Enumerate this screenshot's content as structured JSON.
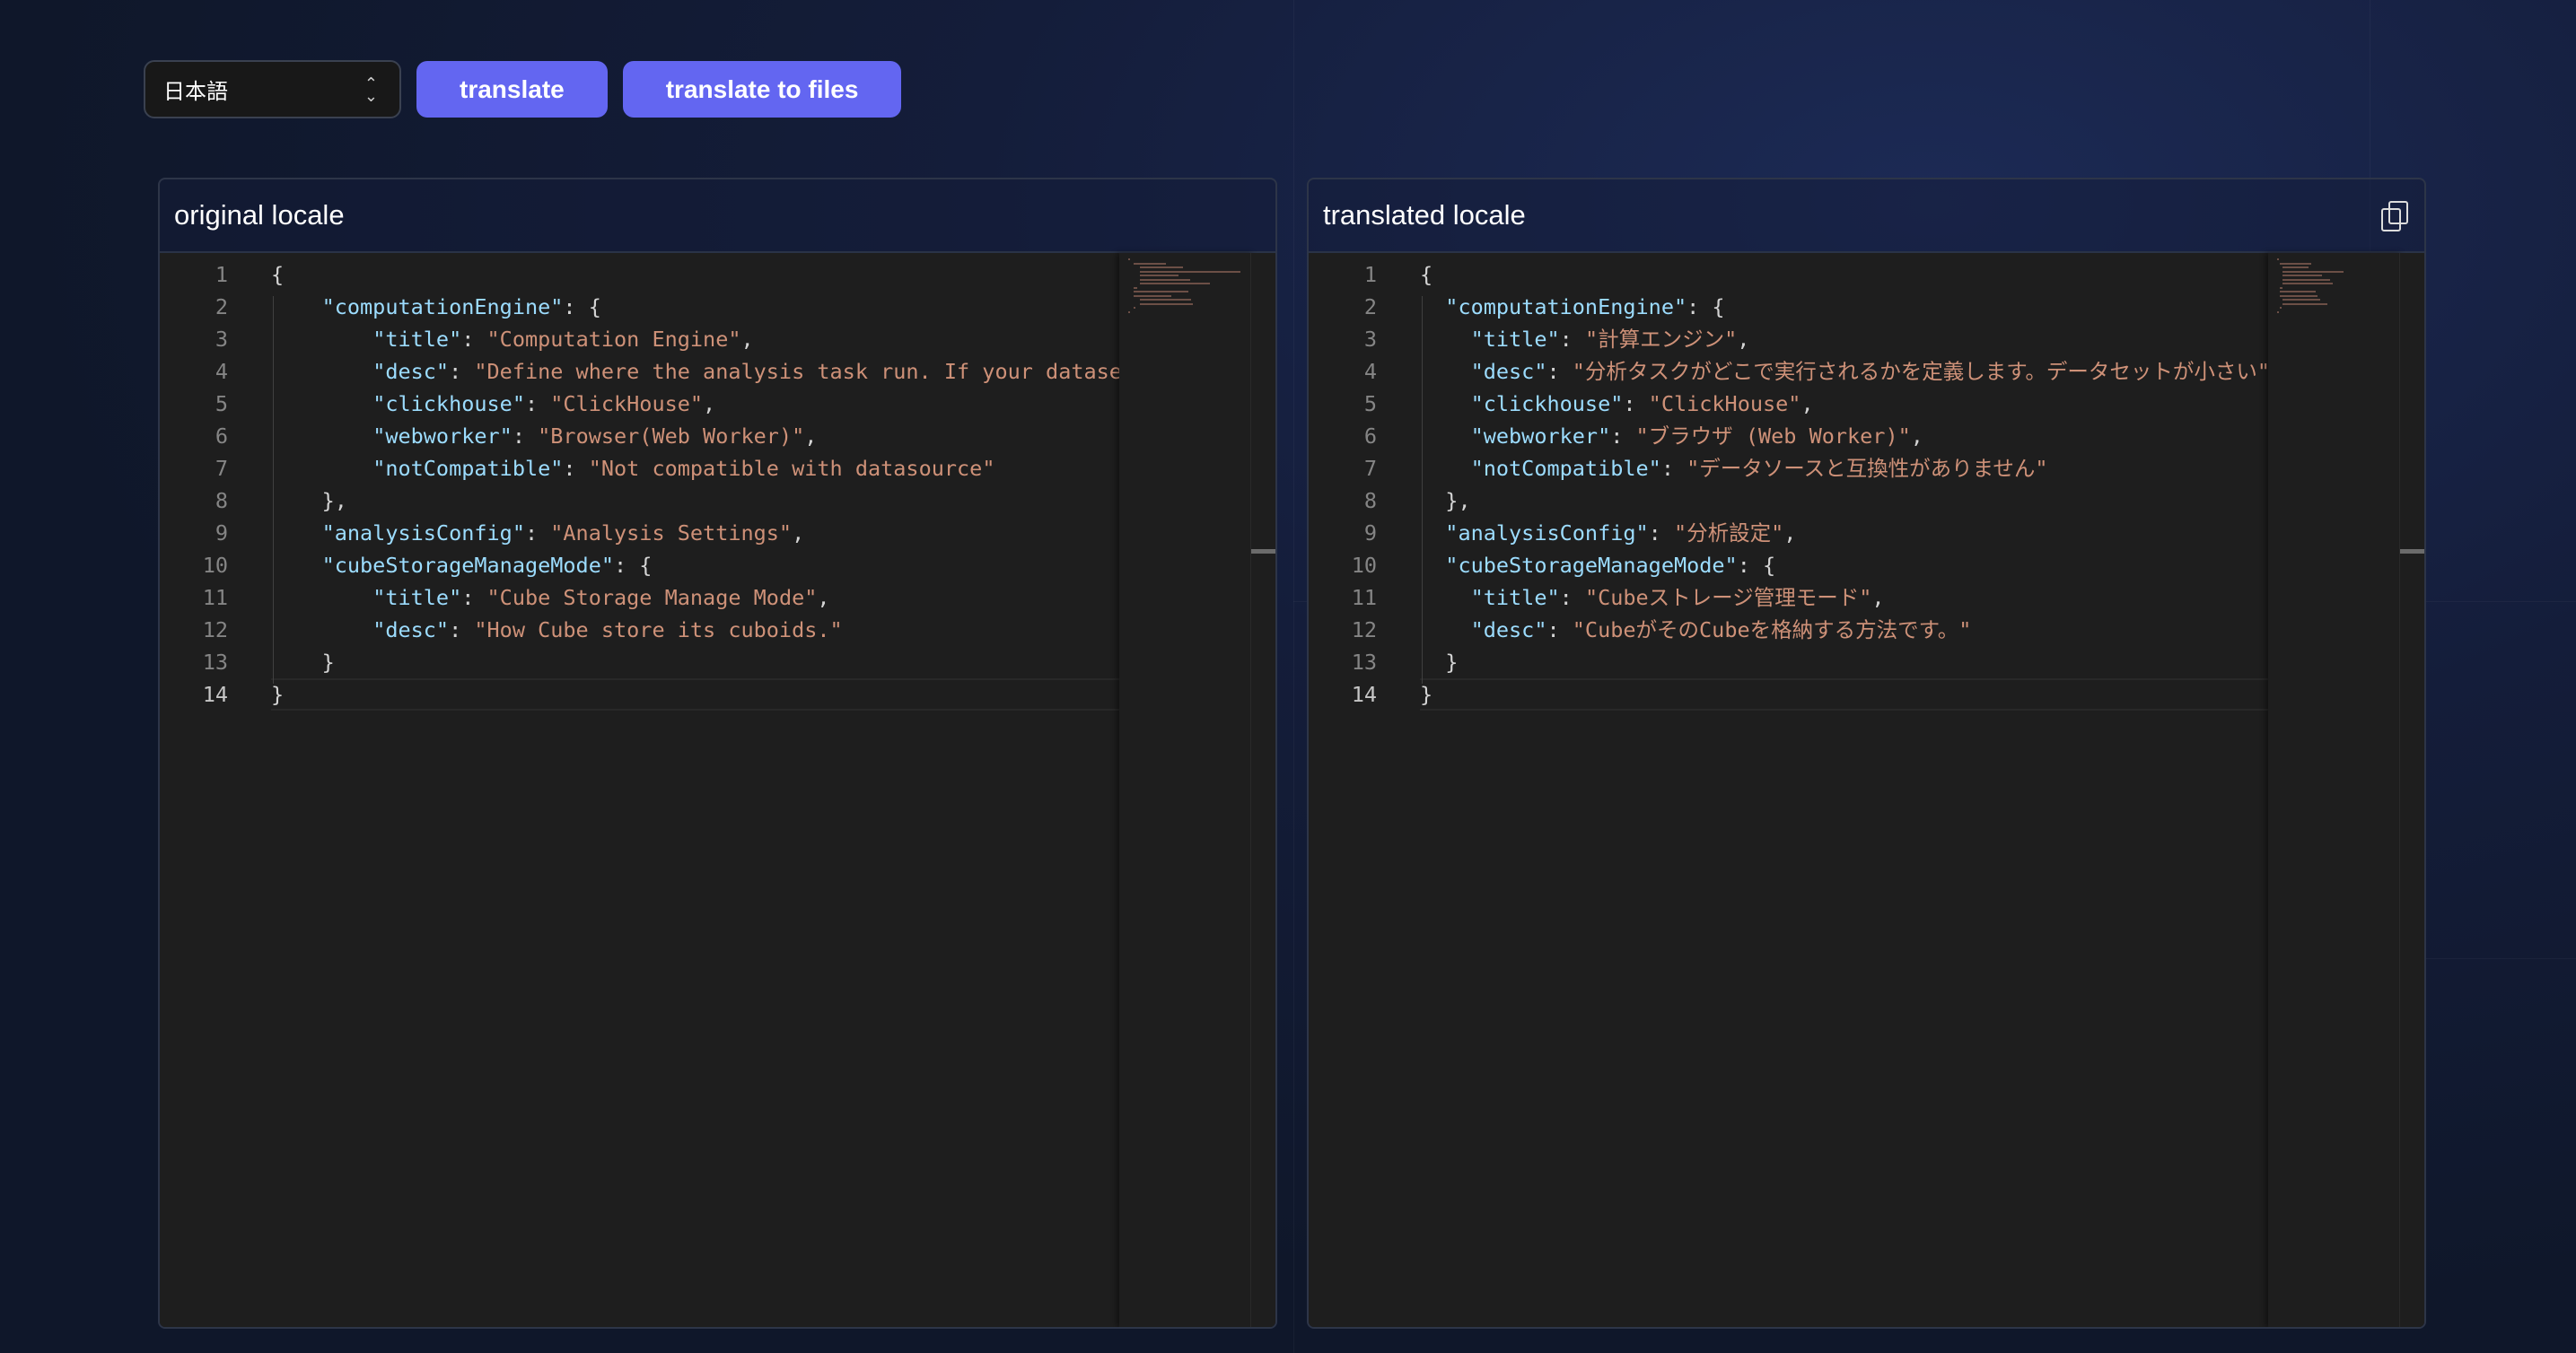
{
  "toolbar": {
    "language_select": {
      "value": "日本語"
    },
    "translate_label": "translate",
    "translate_files_label": "translate to files"
  },
  "colors": {
    "accent": "#6366f1",
    "editor_bg": "#1e1e1e",
    "json_key": "#9cdcfe",
    "json_string": "#ce9178"
  },
  "panels": [
    {
      "title": "original locale",
      "lines": [
        [
          [
            "p",
            "{"
          ]
        ],
        [
          [
            "p",
            "    "
          ],
          [
            "k",
            "\"computationEngine\""
          ],
          [
            "p",
            ": {"
          ]
        ],
        [
          [
            "p",
            "        "
          ],
          [
            "k",
            "\"title\""
          ],
          [
            "p",
            ": "
          ],
          [
            "s",
            "\"Computation Engine\""
          ],
          [
            "p",
            ","
          ]
        ],
        [
          [
            "p",
            "        "
          ],
          [
            "k",
            "\"desc\""
          ],
          [
            "p",
            ": "
          ],
          [
            "s",
            "\"Define where the analysis task run. If your dataset is small\""
          ]
        ],
        [
          [
            "p",
            "        "
          ],
          [
            "k",
            "\"clickhouse\""
          ],
          [
            "p",
            ": "
          ],
          [
            "s",
            "\"ClickHouse\""
          ],
          [
            "p",
            ","
          ]
        ],
        [
          [
            "p",
            "        "
          ],
          [
            "k",
            "\"webworker\""
          ],
          [
            "p",
            ": "
          ],
          [
            "s",
            "\"Browser(Web Worker)\""
          ],
          [
            "p",
            ","
          ]
        ],
        [
          [
            "p",
            "        "
          ],
          [
            "k",
            "\"notCompatible\""
          ],
          [
            "p",
            ": "
          ],
          [
            "s",
            "\"Not compatible with datasource\""
          ]
        ],
        [
          [
            "p",
            "    },"
          ]
        ],
        [
          [
            "p",
            "    "
          ],
          [
            "k",
            "\"analysisConfig\""
          ],
          [
            "p",
            ": "
          ],
          [
            "s",
            "\"Analysis Settings\""
          ],
          [
            "p",
            ","
          ]
        ],
        [
          [
            "p",
            "    "
          ],
          [
            "k",
            "\"cubeStorageManageMode\""
          ],
          [
            "p",
            ": {"
          ]
        ],
        [
          [
            "p",
            "        "
          ],
          [
            "k",
            "\"title\""
          ],
          [
            "p",
            ": "
          ],
          [
            "s",
            "\"Cube Storage Manage Mode\""
          ],
          [
            "p",
            ","
          ]
        ],
        [
          [
            "p",
            "        "
          ],
          [
            "k",
            "\"desc\""
          ],
          [
            "p",
            ": "
          ],
          [
            "s",
            "\"How Cube store its cuboids.\""
          ]
        ],
        [
          [
            "p",
            "    }"
          ]
        ],
        [
          [
            "p",
            "}"
          ]
        ]
      ]
    },
    {
      "title": "translated locale",
      "copy_icon": "copy-icon",
      "lines": [
        [
          [
            "p",
            "{"
          ]
        ],
        [
          [
            "p",
            "  "
          ],
          [
            "k",
            "\"computationEngine\""
          ],
          [
            "p",
            ": {"
          ]
        ],
        [
          [
            "p",
            "    "
          ],
          [
            "k",
            "\"title\""
          ],
          [
            "p",
            ": "
          ],
          [
            "s",
            "\"計算エンジン\""
          ],
          [
            "p",
            ","
          ]
        ],
        [
          [
            "p",
            "    "
          ],
          [
            "k",
            "\"desc\""
          ],
          [
            "p",
            ": "
          ],
          [
            "s",
            "\"分析タスクがどこで実行されるかを定義します。データセットが小さい\""
          ]
        ],
        [
          [
            "p",
            "    "
          ],
          [
            "k",
            "\"clickhouse\""
          ],
          [
            "p",
            ": "
          ],
          [
            "s",
            "\"ClickHouse\""
          ],
          [
            "p",
            ","
          ]
        ],
        [
          [
            "p",
            "    "
          ],
          [
            "k",
            "\"webworker\""
          ],
          [
            "p",
            ": "
          ],
          [
            "s",
            "\"ブラウザ (Web Worker)\""
          ],
          [
            "p",
            ","
          ]
        ],
        [
          [
            "p",
            "    "
          ],
          [
            "k",
            "\"notCompatible\""
          ],
          [
            "p",
            ": "
          ],
          [
            "s",
            "\"データソースと互換性がありません\""
          ]
        ],
        [
          [
            "p",
            "  },"
          ]
        ],
        [
          [
            "p",
            "  "
          ],
          [
            "k",
            "\"analysisConfig\""
          ],
          [
            "p",
            ": "
          ],
          [
            "s",
            "\"分析設定\""
          ],
          [
            "p",
            ","
          ]
        ],
        [
          [
            "p",
            "  "
          ],
          [
            "k",
            "\"cubeStorageManageMode\""
          ],
          [
            "p",
            ": {"
          ]
        ],
        [
          [
            "p",
            "    "
          ],
          [
            "k",
            "\"title\""
          ],
          [
            "p",
            ": "
          ],
          [
            "s",
            "\"Cubeストレージ管理モード\""
          ],
          [
            "p",
            ","
          ]
        ],
        [
          [
            "p",
            "    "
          ],
          [
            "k",
            "\"desc\""
          ],
          [
            "p",
            ": "
          ],
          [
            "s",
            "\"CubeがそのCubeを格納する方法です。\""
          ]
        ],
        [
          [
            "p",
            "  }"
          ]
        ],
        [
          [
            "p",
            "}"
          ]
        ]
      ]
    }
  ]
}
